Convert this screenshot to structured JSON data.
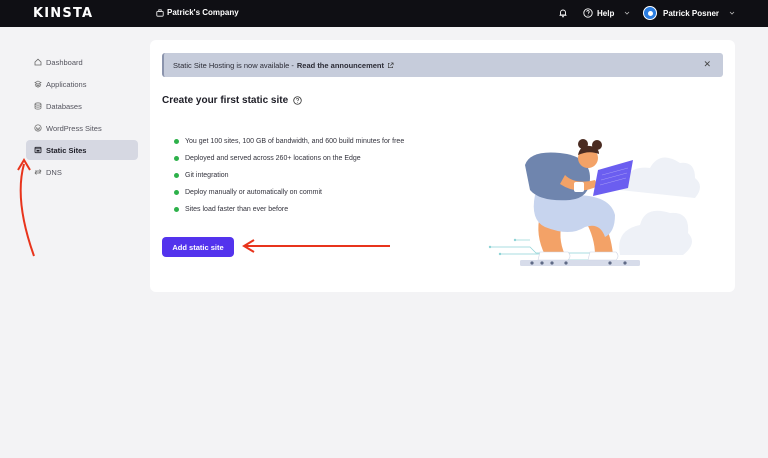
{
  "topbar": {
    "logo": "KINSTA",
    "company": "Patrick's Company",
    "help_label": "Help",
    "user_name": "Patrick Posner"
  },
  "sidebar": {
    "items": [
      {
        "label": "Dashboard",
        "icon": "home-icon"
      },
      {
        "label": "Applications",
        "icon": "layers-icon"
      },
      {
        "label": "Databases",
        "icon": "database-icon"
      },
      {
        "label": "WordPress Sites",
        "icon": "wordpress-icon"
      },
      {
        "label": "Static Sites",
        "icon": "browser-icon",
        "active": true
      },
      {
        "label": "DNS",
        "icon": "dns-icon"
      }
    ]
  },
  "banner": {
    "text": "Static Site Hosting is now available -",
    "link": "Read the announcement"
  },
  "main": {
    "heading": "Create your first static site",
    "features": [
      "You get 100 sites, 100 GB of bandwidth, and 600 build minutes for free",
      "Deployed and served across 260+ locations on the Edge",
      "Git integration",
      "Deploy manually or automatically on commit",
      "Sites load faster than ever before"
    ],
    "add_button": "Add static site"
  },
  "colors": {
    "accent": "#5333ed",
    "check": "#2db14a",
    "annotation": "#e8341c",
    "topbar": "#0f0f14"
  }
}
